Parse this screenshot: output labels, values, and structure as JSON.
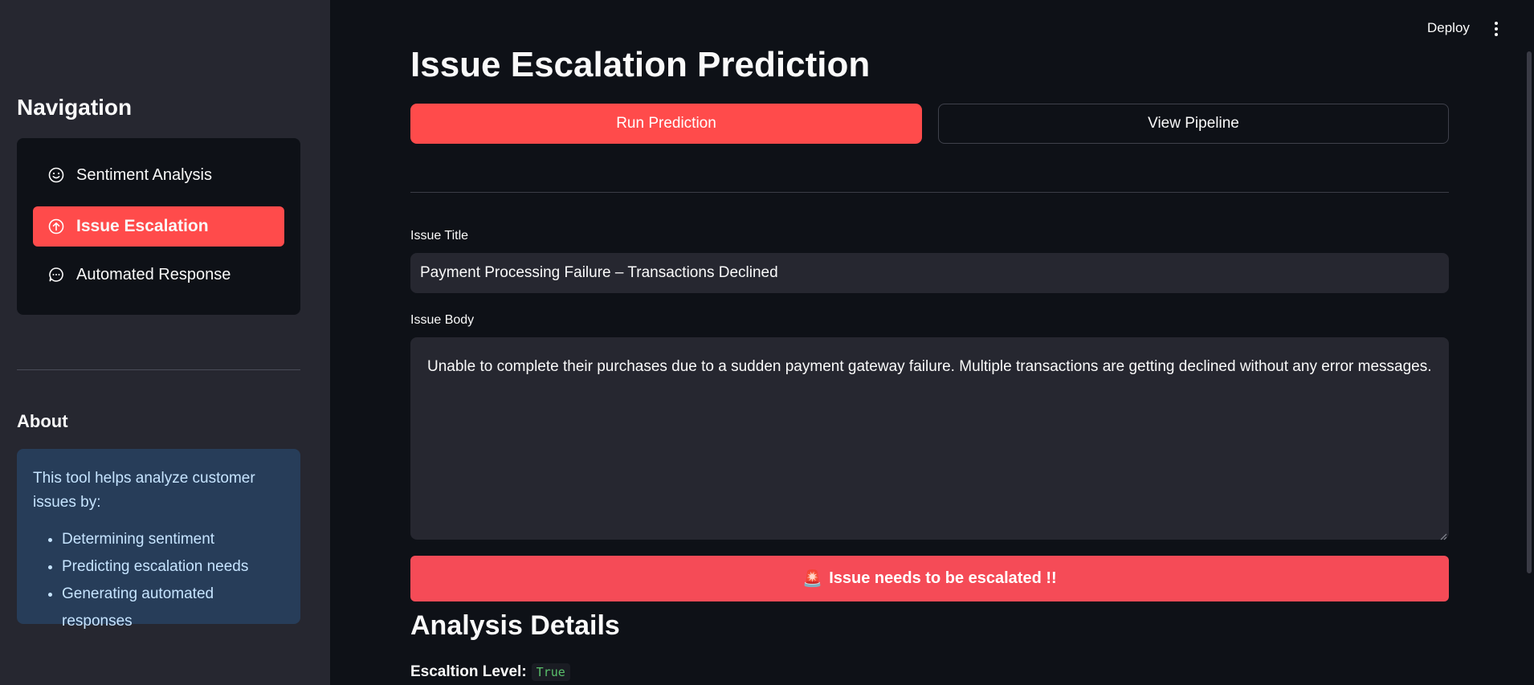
{
  "header": {
    "deploy_label": "Deploy",
    "menu_icon": "vertical-dots-icon"
  },
  "sidebar": {
    "title": "Navigation",
    "items": [
      {
        "label": "Sentiment Analysis",
        "icon": "smiley-icon"
      },
      {
        "label": "Issue Escalation",
        "icon": "arrow-up-circle-icon",
        "active": true
      },
      {
        "label": "Automated Response",
        "icon": "chat-icon"
      }
    ],
    "about": {
      "title": "About",
      "intro": "This tool helps analyze customer issues by:",
      "bullets": [
        "Determining sentiment",
        "Predicting escalation needs",
        "Generating automated responses"
      ]
    }
  },
  "main": {
    "title": "Issue Escalation Prediction",
    "run_button": "Run Prediction",
    "view_button": "View Pipeline",
    "issue_title_label": "Issue Title",
    "issue_title_value": "Payment Processing Failure – Transactions Declined",
    "issue_body_label": "Issue Body",
    "issue_body_value": "Unable to complete their purchases due to a sudden payment gateway failure. Multiple transactions are getting declined without any error messages.",
    "alert_emoji": "🚨",
    "alert_text": "Issue needs to be escalated !!",
    "analysis_title": "Analysis Details",
    "escalation_label": "Escaltion Level:",
    "escalation_value": "True"
  },
  "colors": {
    "accent": "#ff4b4b",
    "alert": "#f54b57",
    "sidebar_bg": "#262730",
    "main_bg": "#0e1117",
    "about_bg": "#273d59"
  }
}
